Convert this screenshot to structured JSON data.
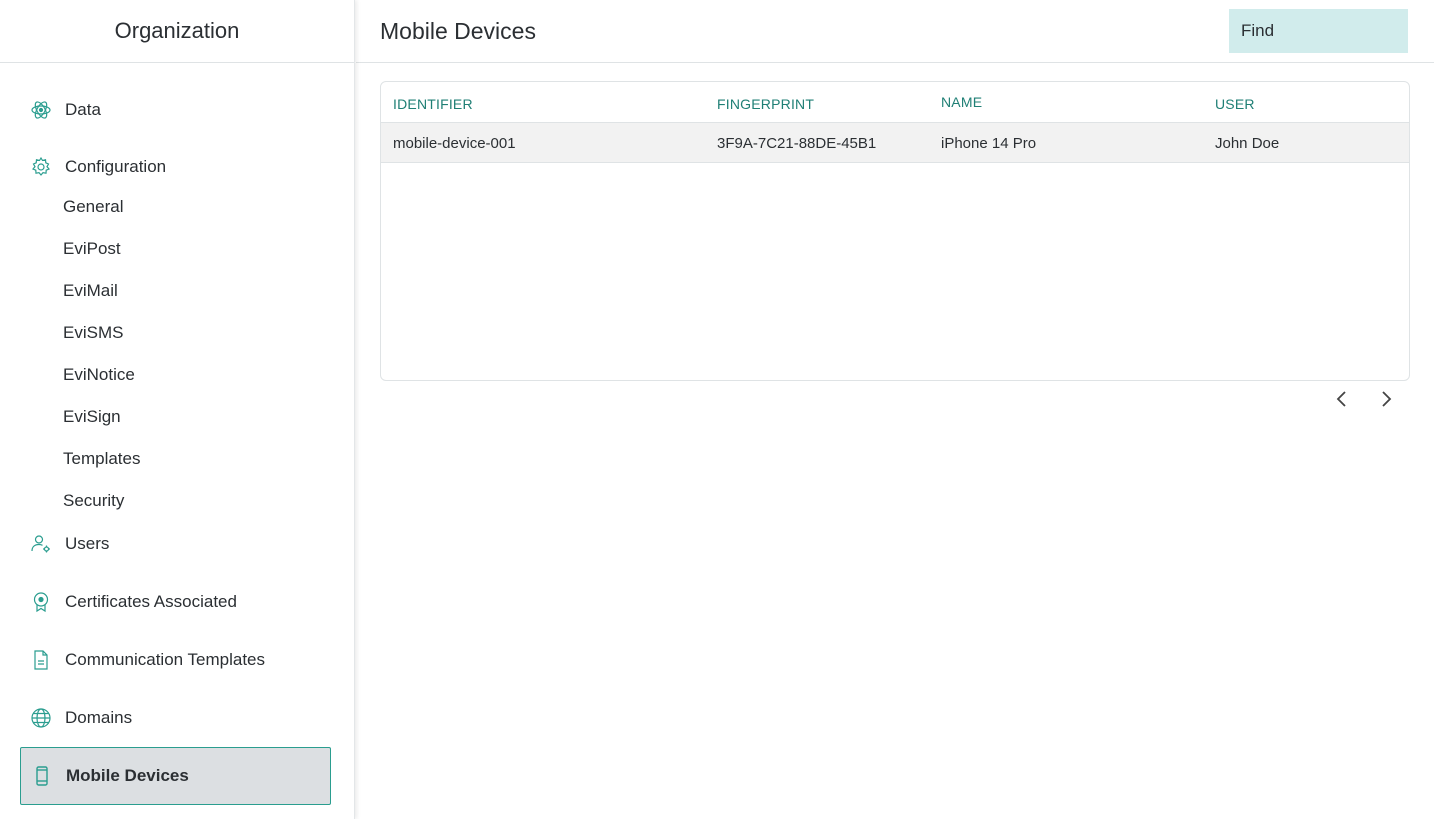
{
  "sidebar": {
    "title": "Organization",
    "items": [
      {
        "label": "Data",
        "icon": "atom-icon"
      },
      {
        "label": "Configuration",
        "icon": "gear-icon"
      },
      {
        "label": "Users",
        "icon": "user-gear-icon"
      },
      {
        "label": "Certificates Associated",
        "icon": "certificate-icon"
      },
      {
        "label": "Communication Templates",
        "icon": "document-icon"
      },
      {
        "label": "Domains",
        "icon": "globe-icon"
      },
      {
        "label": "Mobile Devices",
        "icon": "mobile-icon"
      }
    ],
    "config_subitems": [
      "General",
      "EviPost",
      "EviMail",
      "EviSMS",
      "EviNotice",
      "EviSign",
      "Templates",
      "Security"
    ],
    "active_item": "Mobile Devices"
  },
  "main": {
    "title": "Mobile Devices",
    "search": {
      "placeholder": "Find",
      "value": ""
    },
    "table": {
      "columns": [
        "IDENTIFIER",
        "FINGERPRINT",
        "NAME",
        "USER"
      ],
      "rows": [
        [
          "mobile-device-001",
          "3F9A-7C21-88DE-45B1",
          "iPhone 14 Pro",
          "John Doe"
        ]
      ]
    },
    "pagination": {
      "prev_icon": "chevron-left-icon",
      "next_icon": "chevron-right-icon"
    }
  },
  "colors": {
    "accent": "#2a9d8f",
    "header_text": "#1f7f75",
    "search_bg": "#d1ecec",
    "active_bg": "#dcdfe2"
  }
}
